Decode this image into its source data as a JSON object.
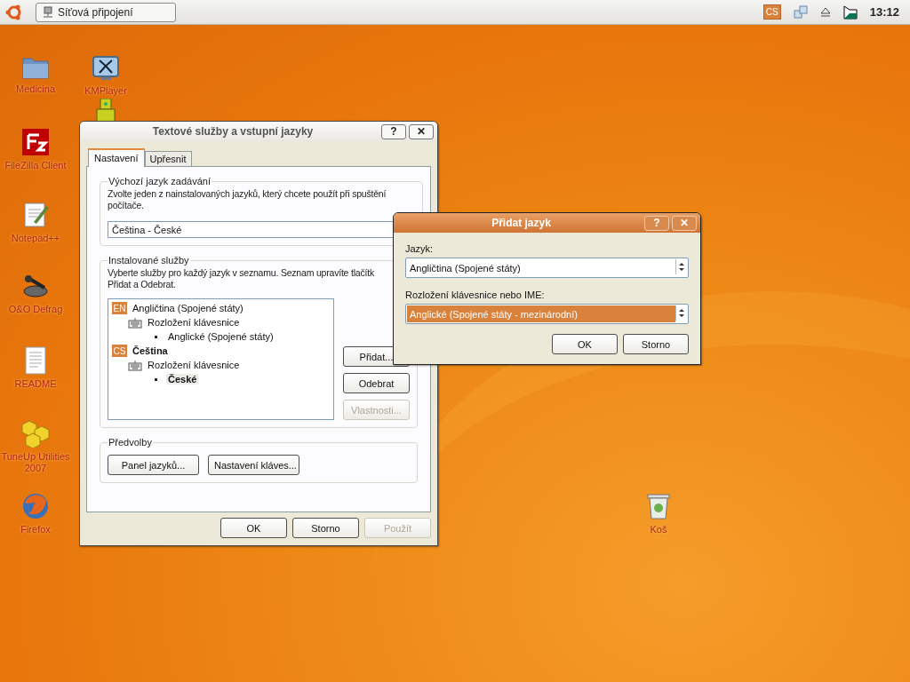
{
  "top_panel": {
    "window_button": "Síťová připojení",
    "tray_badge": "CS",
    "clock": "13:12"
  },
  "desktop_icons": [
    {
      "label": "Medicina",
      "kind": "folder"
    },
    {
      "label": "KMPlayer",
      "kind": "player"
    },
    {
      "label": "FileZilla Client",
      "kind": "filezilla"
    },
    {
      "label": "Notepad++",
      "kind": "notepad"
    },
    {
      "label": "O&O Defrag",
      "kind": "defrag"
    },
    {
      "label": "README",
      "kind": "document"
    },
    {
      "label": "TuneUp Utilities 2007",
      "kind": "tuneup"
    },
    {
      "label": "Firefox",
      "kind": "browser"
    },
    {
      "label": "Koš",
      "kind": "trash"
    }
  ],
  "main_dialog": {
    "title": "Textové služby a vstupní jazyky",
    "title_buttons": [
      "?",
      "✕"
    ],
    "tabs": [
      {
        "label": "Nastavení",
        "selected": true
      },
      {
        "label": "Upřesnit",
        "selected": false
      }
    ],
    "default_language": {
      "legend": "Výchozí jazyk zadávání",
      "description": [
        "Zvolte jeden z nainstalovaných jazyků, který chcete použít při spuštění",
        "počítače."
      ],
      "value": "Čeština - České"
    },
    "installed_services": {
      "legend": "Instalované služby",
      "description": [
        "Vyberte služby pro každý jazyk v seznamu. Seznam upravíte tlačítk",
        "Přidat a Odebrat."
      ],
      "tree": [
        {
          "badge": "EN",
          "label": "Angličtina (Spojené státy)",
          "default": false,
          "children": [
            {
              "label": "Rozložení klávesnice",
              "children": [
                {
                  "label": "Anglické (Spojené státy)",
                  "selected": false
                }
              ]
            }
          ]
        },
        {
          "badge": "CS",
          "label": "Čeština",
          "default": true,
          "children": [
            {
              "label": "Rozložení klávesnice",
              "children": [
                {
                  "label": "České",
                  "selected": true
                }
              ]
            }
          ]
        }
      ],
      "buttons": [
        {
          "label": "Přidat...",
          "disabled": false
        },
        {
          "label": "Odebrat",
          "disabled": false
        },
        {
          "label": "Vlastnosti...",
          "disabled": true
        }
      ]
    },
    "preferences": {
      "legend": "Předvolby",
      "buttons": [
        "Panel jazyků...",
        "Nastavení kláves..."
      ]
    },
    "footer_buttons": [
      {
        "label": "OK",
        "disabled": false
      },
      {
        "label": "Storno",
        "disabled": false
      },
      {
        "label": "Použít",
        "disabled": true
      }
    ]
  },
  "add_dialog": {
    "title": "Přidat jazyk",
    "title_buttons": [
      "?",
      "✕"
    ],
    "fields": [
      {
        "label": "Jazyk:",
        "value": "Angličtina (Spojené státy)",
        "selected": false
      },
      {
        "label": "Rozložení klávesnice nebo IME:",
        "value": "Anglické (Spojené státy - mezinárodní)",
        "selected": true
      }
    ],
    "buttons": [
      "OK",
      "Storno"
    ]
  }
}
